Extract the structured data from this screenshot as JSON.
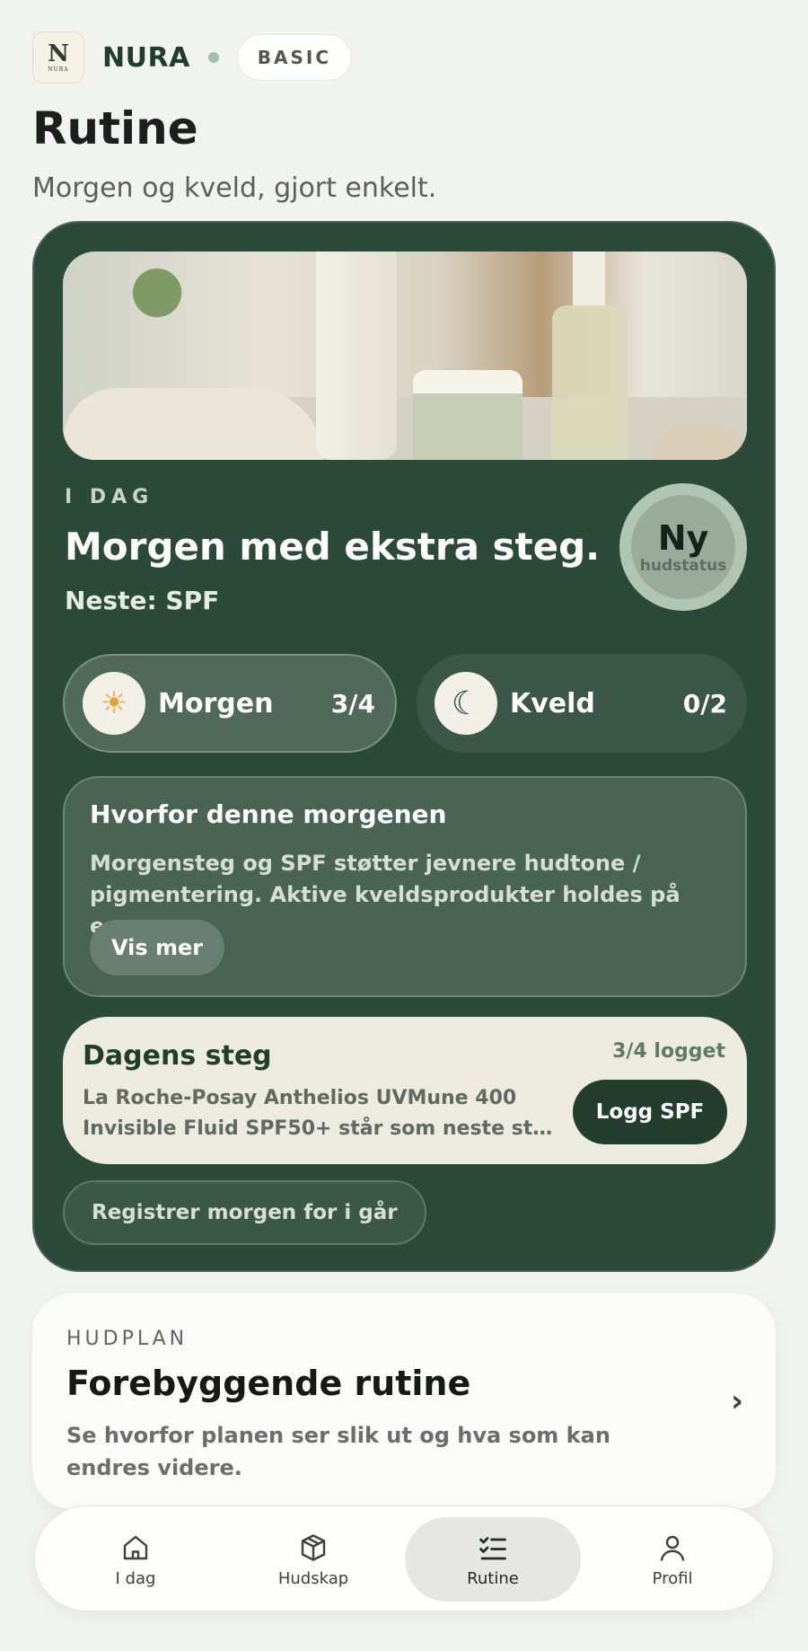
{
  "header": {
    "logo_letter": "N",
    "logo_text": "NURA",
    "brand_name": "NURA",
    "plan_badge": "BASIC",
    "title": "Rutine",
    "subtitle": "Morgen og kveld, gjort enkelt."
  },
  "today": {
    "label": "I DAG",
    "title": "Morgen med ekstra steg.",
    "next": "Neste: SPF",
    "status_big": "Ny",
    "status_small": "hudstatus"
  },
  "segments": [
    {
      "label": "Morgen",
      "count": "3/4",
      "icon": "sun-icon"
    },
    {
      "label": "Kveld",
      "count": "0/2",
      "icon": "moon-icon"
    }
  ],
  "why": {
    "title": "Hvorfor denne morgenen",
    "text": "Morgensteg og SPF støtter jevnere hudtone / pigmentering. Aktive kveldsprodukter holdes på egne…",
    "button": "Vis mer"
  },
  "step": {
    "title": "Dagens steg",
    "logged": "3/4 logget",
    "text": "La Roche-Posay Anthelios UVMune 400 Invisible Fluid SPF50+ står som neste st…",
    "button": "Logg SPF"
  },
  "register_button": "Registrer morgen for i går",
  "plan": {
    "label": "HUDPLAN",
    "title": "Forebyggende rutine",
    "text": "Se hvorfor planen ser slik ut og hva som kan endres videre."
  },
  "tabs": [
    {
      "label": "I dag",
      "icon": "home-icon"
    },
    {
      "label": "Hudskap",
      "icon": "box-icon"
    },
    {
      "label": "Rutine",
      "icon": "checklist-icon",
      "active": true
    },
    {
      "label": "Profil",
      "icon": "person-icon"
    }
  ],
  "colors": {
    "background": "#f1f3ef",
    "card": "#2b4a3a",
    "accent_dot": "#9fc3a3",
    "primary_button": "#233d2f"
  }
}
